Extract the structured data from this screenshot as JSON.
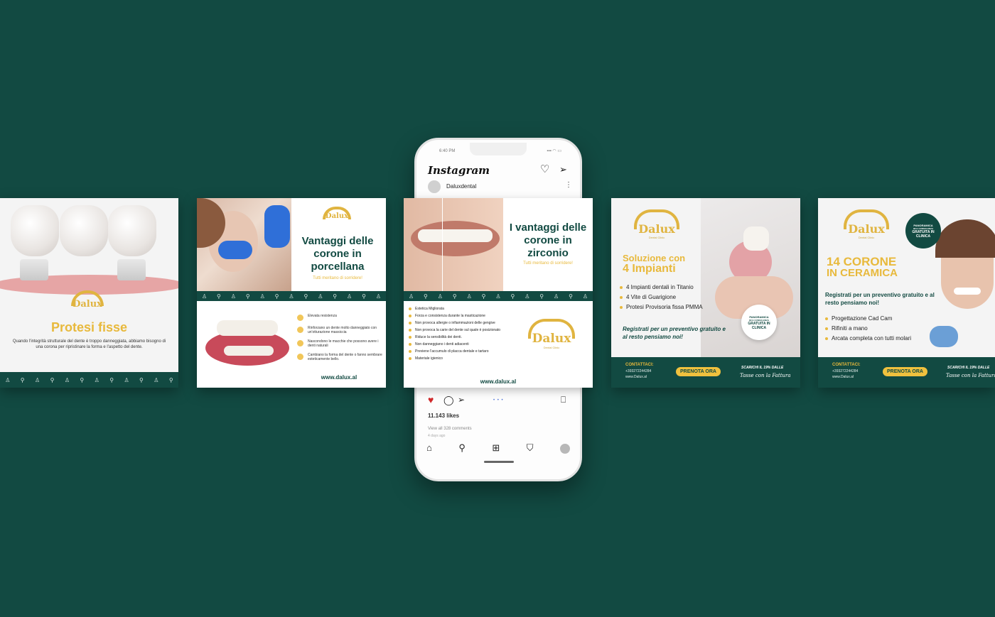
{
  "colors": {
    "background": "#124a42",
    "gold": "#e8b93c",
    "white": "#ffffff"
  },
  "card1": {
    "logo": "Dalux",
    "title": "Protesi fisse",
    "body": "Quando l'integrità strutturale del dente è troppo danneggiata, abbiamo bisogno di una corona per ripristinare la forma e l'aspetto del dente."
  },
  "card2": {
    "logo": "Dalux",
    "title": "Vantaggi delle corone in porcellana",
    "subtitle": "Tutti meritano di sorridere!",
    "items": [
      "Elevata resistenza",
      "Rinforzano un dente molto danneggiato con un'otturazione massiccia",
      "Nascondono le macchie che possono avere i denti naturali",
      "Cambiano la forma del dente o fanno sembrare esteticamente bello."
    ],
    "url": "www.dalux.al"
  },
  "phone": {
    "time": "6:40 PM",
    "app_name": "Instagram",
    "account": "Daluxdental",
    "likes": "11.143 likes",
    "comments": "View all 328 comments",
    "ago": "4 days ago"
  },
  "card3": {
    "title": "I vantaggi delle corone in zirconio",
    "subtitle": "Tutti meritano di sorridere!",
    "items": [
      "Estetica Migliorata",
      "Forza e consistenza durante la masticazione",
      "Non provoca allergie o infiammazioni delle gengive",
      "Non provoca la carie del dente sul quale è posizionato",
      "Riduce la sensibilità dei denti.",
      "Non danneggiano i denti adiacenti",
      "Previene l'accumulo di placca dentale e tartaro",
      "Materiale igienico"
    ],
    "logo": "Dalux",
    "logo_sub": "Dental Clinic",
    "url": "www.dalux.al"
  },
  "card4": {
    "logo": "Dalux",
    "logo_sub": "Dental Clinic",
    "title_line1": "Soluzione con",
    "title_line2": "4 Impianti",
    "items": [
      "4 Impianti dentali in Titanio",
      "4 Vite di Guarigione",
      "Protesi Provisoria fissa PMMA"
    ],
    "cta": "Registrati per un preventivo gratuito e al resto pensiamo noi!",
    "badge_top": "PANORAMICA",
    "badge_mid": "3D E CONSULENZA",
    "badge_bottom": "GRATUITA IN CLINICA",
    "contact_label": "CONTATTACI:",
    "phone": "+393272244284",
    "site": "www.Dalux.al",
    "button": "PRENOTA ORA",
    "tax_line1": "SCARICHI IL 19% DALLE",
    "tax_line2": "Tasse con la Fattura"
  },
  "card5": {
    "logo": "Dalux",
    "logo_sub": "Dental Clinic",
    "title_line1": "14 CORONE",
    "title_line2": "IN CERAMICA",
    "cta": "Registrati per un preventivo gratuito e al resto pensiamo noi!",
    "items": [
      "Progettazione Cad Cam",
      "Rifiniti a mano",
      "Arcata completa con tutti molari"
    ],
    "badge_top": "PANORAMICA",
    "badge_mid": "3D E CONSULENZA",
    "badge_bottom": "GRATUITA IN CLINICA",
    "contact_label": "CONTATTACI:",
    "phone": "+393272244284",
    "site": "www.Dalux.al",
    "button": "PRENOTA ORA",
    "tax_line1": "SCARICHI IL 19% DALLE",
    "tax_line2": "Tasse con la Fattura"
  }
}
